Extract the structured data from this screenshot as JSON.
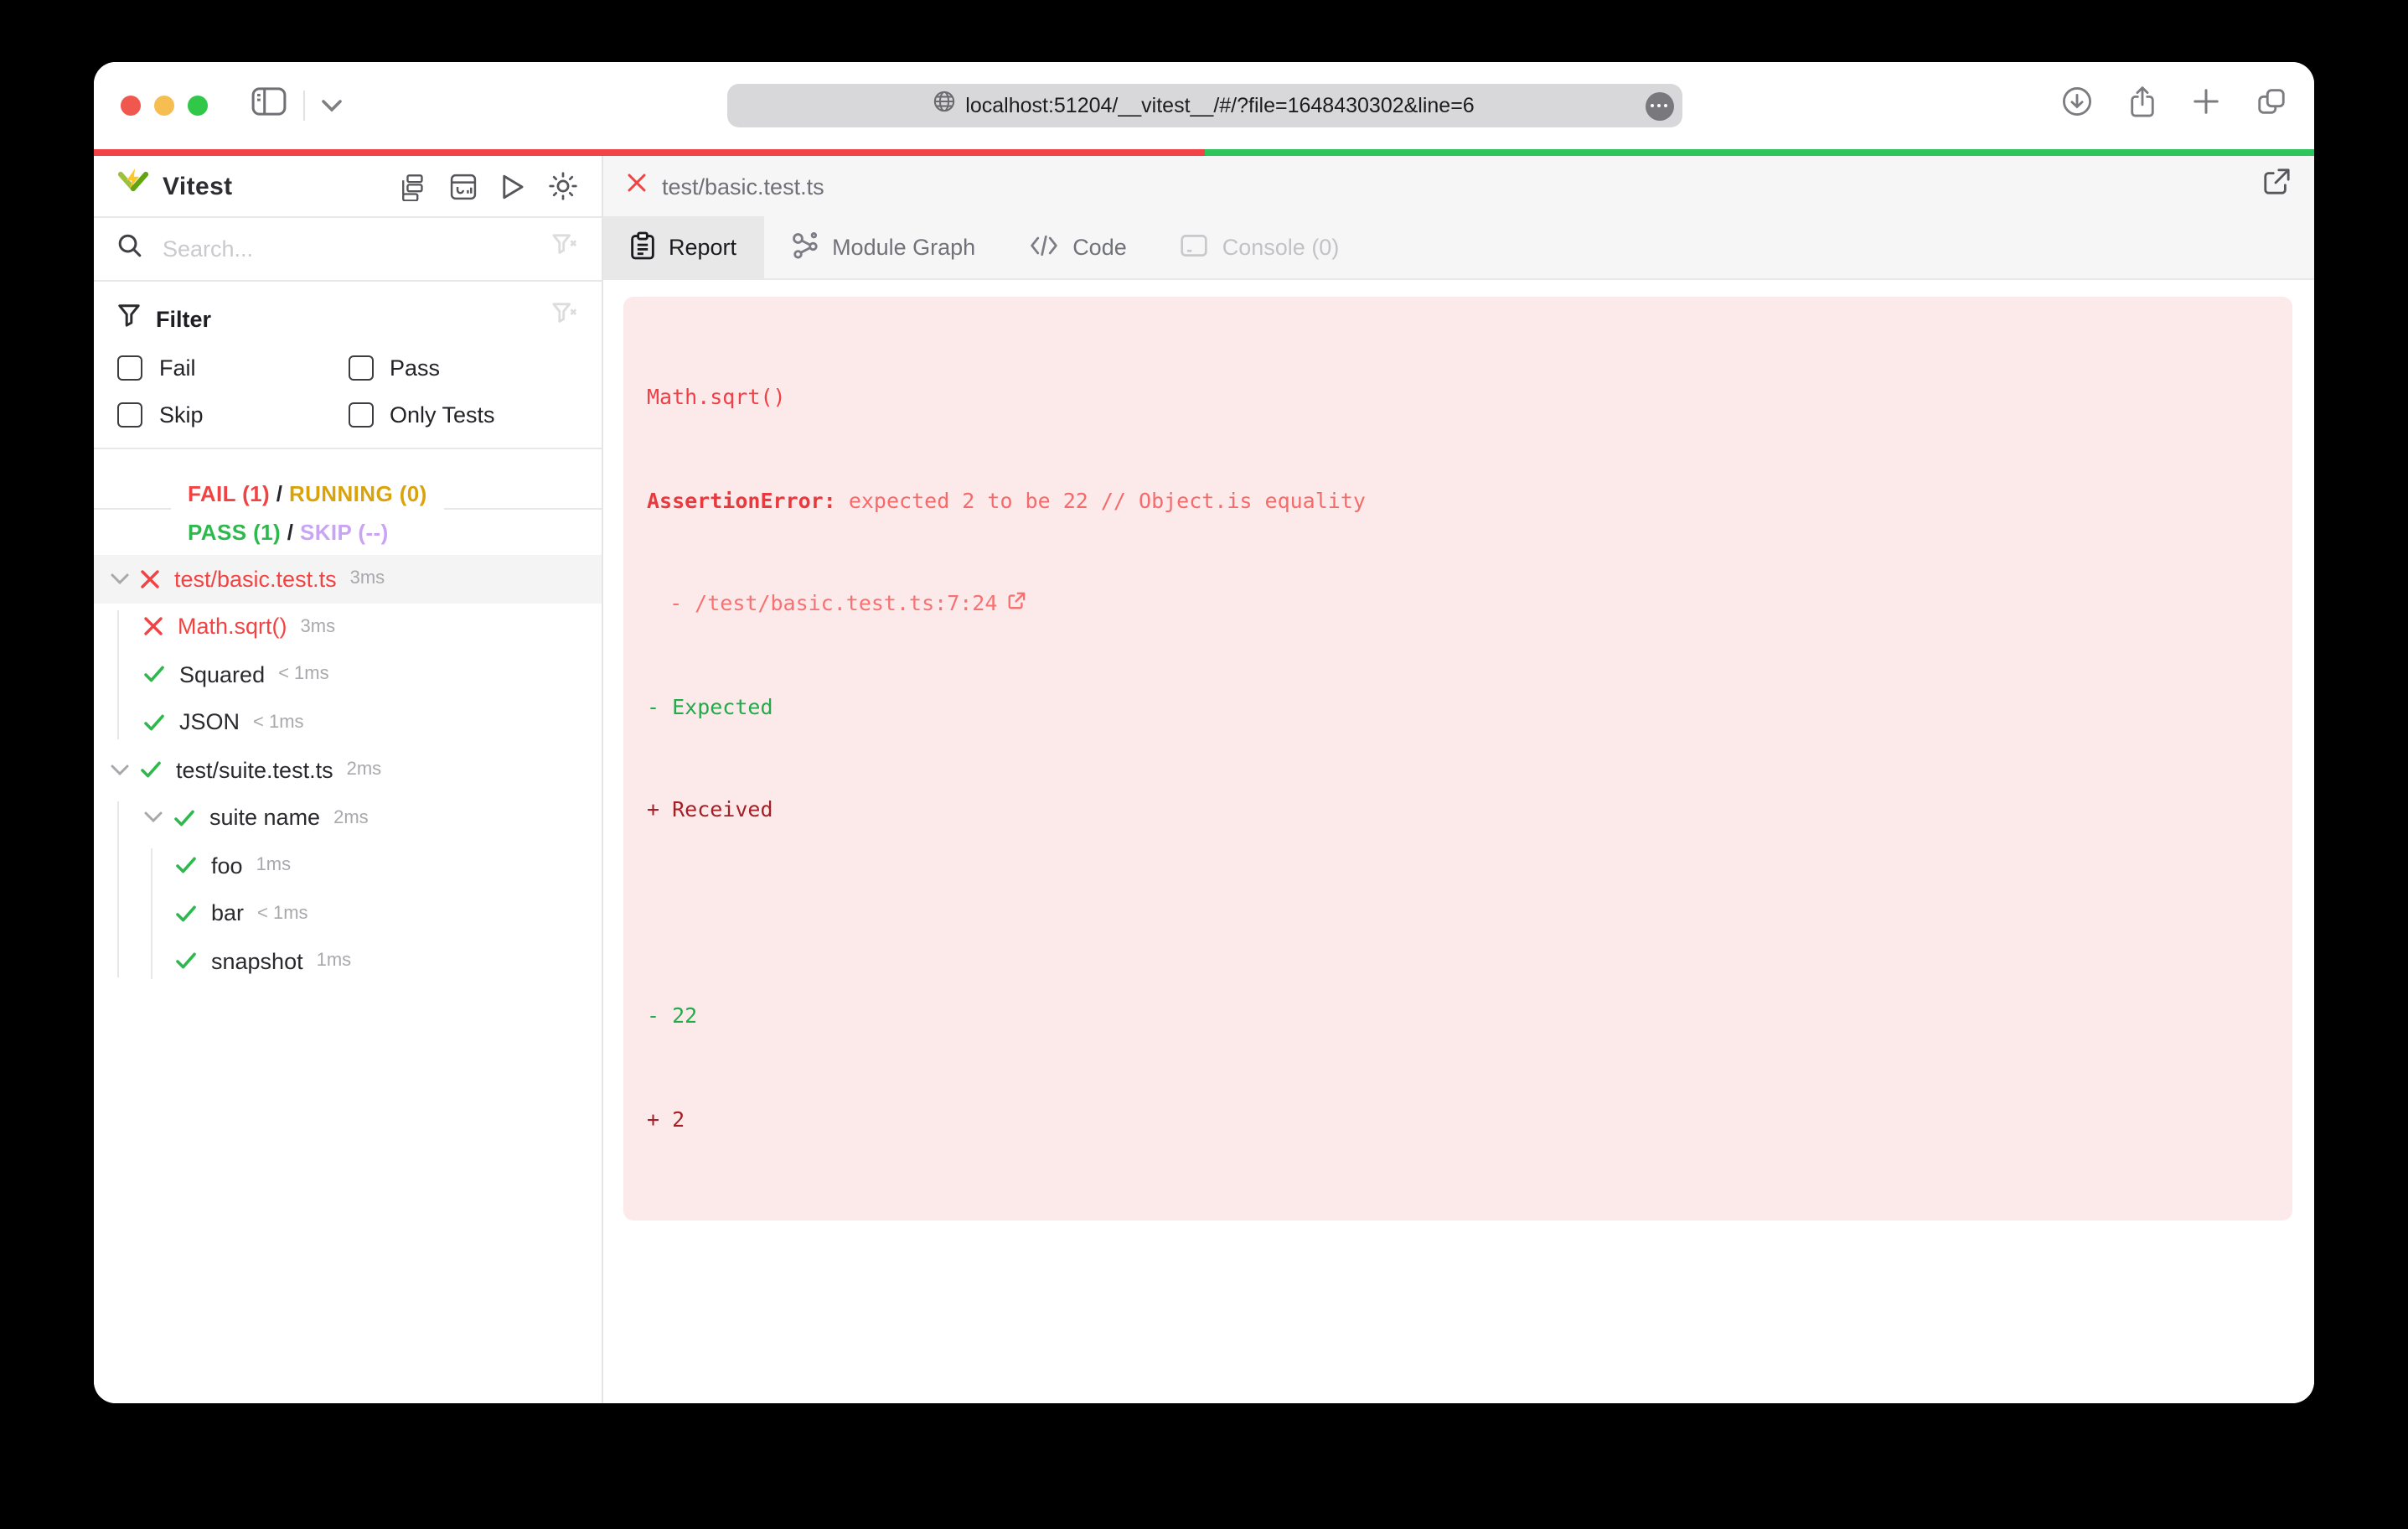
{
  "browser": {
    "url": "localhost:51204/__vitest__/#/?file=1648430302&line=6",
    "traffic_light_colors": {
      "close": "#f0574f",
      "minimize": "#f6be50",
      "zoom": "#31c748"
    }
  },
  "progress": {
    "segments": [
      {
        "name": "fail",
        "color": "#f0444a",
        "pct": 50
      },
      {
        "name": "pass",
        "color": "#2ec45e",
        "pct": 50
      }
    ]
  },
  "sidebar": {
    "brand": "Vitest",
    "search_placeholder": "Search...",
    "filter": {
      "title": "Filter",
      "options": [
        "Fail",
        "Pass",
        "Skip",
        "Only Tests"
      ]
    },
    "summary": {
      "fail": "FAIL (1)",
      "running": "RUNNING (0)",
      "pass": "PASS (1)",
      "skip": "SKIP (--)",
      "sep": "/"
    },
    "tree": [
      {
        "label": "test/basic.test.ts",
        "time": "3ms",
        "state": "fail",
        "depth": 0,
        "expandable": true,
        "selected": true
      },
      {
        "label": "Math.sqrt()",
        "time": "3ms",
        "state": "fail",
        "depth": 1
      },
      {
        "label": "Squared",
        "time": "< 1ms",
        "state": "pass",
        "depth": 1
      },
      {
        "label": "JSON",
        "time": "< 1ms",
        "state": "pass",
        "depth": 1
      },
      {
        "label": "test/suite.test.ts",
        "time": "2ms",
        "state": "pass",
        "depth": 0,
        "expandable": true
      },
      {
        "label": "suite name",
        "time": "2ms",
        "state": "pass",
        "depth": 1,
        "expandable": true
      },
      {
        "label": "foo",
        "time": "1ms",
        "state": "pass",
        "depth": 2
      },
      {
        "label": "bar",
        "time": "< 1ms",
        "state": "pass",
        "depth": 2
      },
      {
        "label": "snapshot",
        "time": "1ms",
        "state": "pass",
        "depth": 2
      }
    ]
  },
  "main": {
    "file": "test/basic.test.ts",
    "tabs": [
      "Report",
      "Module Graph",
      "Code",
      "Console (0)"
    ],
    "report": {
      "test_name": "Math.sqrt()",
      "error_label": "AssertionError:",
      "error_message": " expected 2 to be 22 // Object.is equality",
      "stack_link": "- /test/basic.test.ts:7:24",
      "expected_label": "- Expected",
      "received_label": "+ Received",
      "expected_value": "- 22",
      "received_value": "+ 2"
    }
  },
  "colors": {
    "fail": "#f04444",
    "running": "#d9a40b",
    "pass": "#2eb94e",
    "skip": "#c9a4f5",
    "error_bg": "#fce9e9"
  }
}
